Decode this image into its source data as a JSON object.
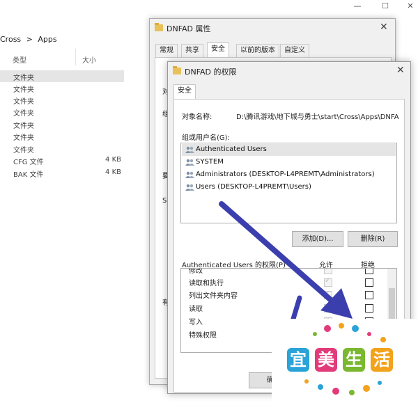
{
  "explorer": {
    "breadcrumb": [
      "Cross",
      "Apps"
    ],
    "breadcrumb_sep": ">",
    "col_type": "类型",
    "col_size": "大小",
    "rows": [
      {
        "type": "文件夹",
        "size": ""
      },
      {
        "type": "文件夹",
        "size": ""
      },
      {
        "type": "文件夹",
        "size": ""
      },
      {
        "type": "文件夹",
        "size": ""
      },
      {
        "type": "文件夹",
        "size": ""
      },
      {
        "type": "文件夹",
        "size": ""
      },
      {
        "type": "文件夹",
        "size": ""
      },
      {
        "type": "CFG 文件",
        "size": "4 KB"
      },
      {
        "type": "BAK 文件",
        "size": "4 KB"
      }
    ],
    "controls": [
      "—",
      "☐",
      "✕"
    ]
  },
  "props": {
    "title": "DNFAD 属性",
    "tabs": [
      "常规",
      "共享",
      "安全",
      "以前的版本",
      "自定义"
    ],
    "active_tab": "安全",
    "peek_left": [
      "对",
      "组",
      "要",
      "S",
      "有"
    ]
  },
  "perm": {
    "title": "DNFAD 的权限",
    "tab": "安全",
    "object_label": "对象名称:",
    "object_path": "D:\\腾讯游戏\\地下城与勇士\\start\\Cross\\Apps\\DNFA",
    "group_label": "组或用户名(G):",
    "users": [
      "Authenticated Users",
      "SYSTEM",
      "Administrators (DESKTOP-L4PREMT\\Administrators)",
      "Users (DESKTOP-L4PREMT\\Users)"
    ],
    "add_button": "添加(D)...",
    "remove_button": "删除(R)",
    "perm_header": "Authenticated Users 的权限(P)",
    "allow_header": "允许",
    "deny_header": "拒绝",
    "permissions": [
      {
        "name": "修改",
        "allow": true,
        "deny": false
      },
      {
        "name": "读取和执行",
        "allow": true,
        "deny": false
      },
      {
        "name": "列出文件夹内容",
        "allow": true,
        "deny": false
      },
      {
        "name": "读取",
        "allow": true,
        "deny": false
      },
      {
        "name": "写入",
        "allow": true,
        "deny": false
      },
      {
        "name": "特殊权限",
        "allow": false,
        "deny": false
      }
    ],
    "ok_button_partial": "确"
  },
  "watermark": {
    "chars": [
      "宜",
      "美",
      "生",
      "活"
    ]
  },
  "colors": {
    "arrow": "#3b3fae",
    "selection": "#e5e5e5",
    "logo": [
      "#2aa3d8",
      "#e23b7a",
      "#7ab830",
      "#f3a21b"
    ]
  }
}
